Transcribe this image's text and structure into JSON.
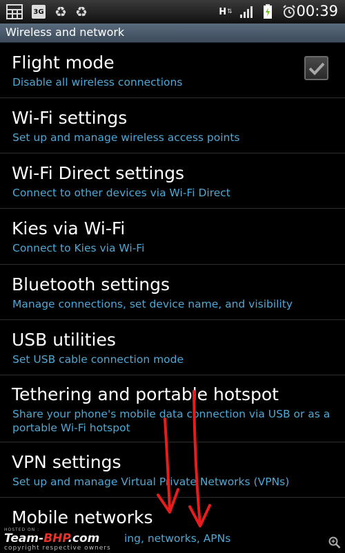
{
  "status_bar": {
    "icons": [
      "grid-icon",
      "3g-icon",
      "recycle-icon",
      "recycle-icon",
      "h-data-icon",
      "signal-icon",
      "battery-icon",
      "alarm-icon"
    ],
    "network_badge": "3G",
    "data_type": "H",
    "time": "00:39"
  },
  "title": "Wireless and network",
  "items": [
    {
      "title": "Flight mode",
      "subtitle": "Disable all wireless connections",
      "checked": true
    },
    {
      "title": "Wi-Fi settings",
      "subtitle": "Set up and manage wireless access points"
    },
    {
      "title": "Wi-Fi Direct settings",
      "subtitle": "Connect to other devices via Wi-Fi Direct"
    },
    {
      "title": "Kies via Wi-Fi",
      "subtitle": "Connect to Kies via Wi-Fi"
    },
    {
      "title": "Bluetooth settings",
      "subtitle": "Manage connections, set device name, and visibility"
    },
    {
      "title": "USB utilities",
      "subtitle": "Set USB cable connection mode"
    },
    {
      "title": "Tethering and portable hotspot",
      "subtitle_line1": "Share your phone's mobile data connection via USB or as a",
      "subtitle_line2": "portable Wi-Fi hotspot"
    },
    {
      "title": "VPN settings",
      "subtitle": "Set up and manage Virtual Private Networks (VPNs)"
    },
    {
      "title": "Mobile networks",
      "subtitle": "ing, networks, APNs"
    }
  ],
  "watermark": {
    "hosted": "HOSTED ON :",
    "brand_prefix": "Team-",
    "brand_highlight": "BHP",
    "brand_suffix": ".com",
    "copyright": "copyright respective owners"
  },
  "colors": {
    "accent": "#4fa8d6",
    "annotation": "#e81c1c",
    "title_bar": "#4a5a6b"
  }
}
